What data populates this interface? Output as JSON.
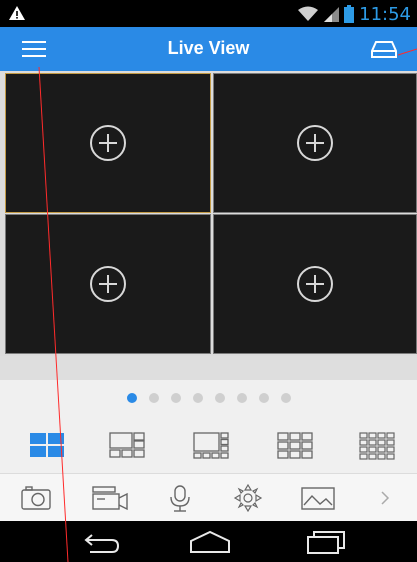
{
  "status": {
    "time": "11:54",
    "icons": [
      "warning-icon",
      "wifi-icon",
      "signal-icon",
      "battery-icon"
    ]
  },
  "header": {
    "title": "Live View",
    "icons": [
      "menu-icon",
      "drive-icon"
    ]
  },
  "grid": {
    "cells": [
      {
        "icon": "add-icon"
      },
      {
        "icon": "add-icon"
      },
      {
        "icon": "add-icon"
      },
      {
        "icon": "add-icon"
      }
    ]
  },
  "pager": {
    "pages": 8,
    "active_index": 0
  },
  "layouts": [
    {
      "name": "layout-4",
      "active": true
    },
    {
      "name": "layout-6",
      "active": false
    },
    {
      "name": "layout-8",
      "active": false
    },
    {
      "name": "layout-9",
      "active": false
    },
    {
      "name": "layout-16",
      "active": false
    }
  ],
  "toolbar": {
    "icons": [
      "snapshot-icon",
      "record-icon",
      "microphone-icon",
      "ptz-icon",
      "image-icon",
      "next-arrow-icon"
    ]
  },
  "navbar": {
    "icons": [
      "back-icon",
      "home-icon",
      "recent-apps-icon"
    ]
  },
  "colors": {
    "accent": "#2a8ae6",
    "panel": "#f0f0f0",
    "cell": "#1a1a1a",
    "active_border": "#c29a45"
  }
}
